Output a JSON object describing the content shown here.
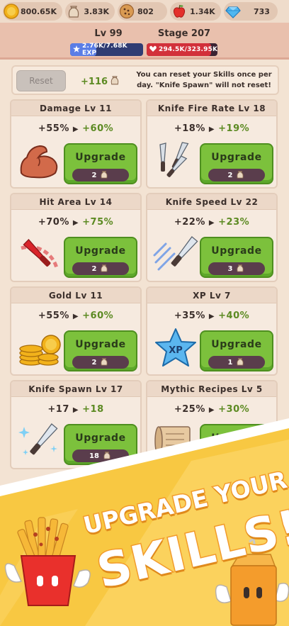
{
  "resources": [
    {
      "name": "coins",
      "value": "800.65K",
      "icon": "gold-coin-icon"
    },
    {
      "name": "flour",
      "value": "3.83K",
      "icon": "flour-sack-icon"
    },
    {
      "name": "cookies",
      "value": "802",
      "icon": "cookie-icon"
    },
    {
      "name": "apples",
      "value": "1.34K",
      "icon": "apple-icon"
    },
    {
      "name": "gems",
      "value": "733",
      "icon": "diamond-icon"
    }
  ],
  "header": {
    "level": "Lv 99",
    "stage": "Stage 207",
    "exp": {
      "text": "2.76K/7.68K EXP",
      "progress": 0.36
    },
    "hp": {
      "text": "294.5K/323.95K",
      "progress": 0.91
    }
  },
  "reset": {
    "button_label": "Reset",
    "count": "+116",
    "note": "You can reset your Skills once per day. \"Knife Spawn\" will not reset!"
  },
  "skills": [
    {
      "title": "Damage Lv 11",
      "current": "+55%",
      "next": "+60%",
      "upgrade_label": "Upgrade",
      "cost": "2",
      "icon": "flexed-arm-icon"
    },
    {
      "title": "Knife Fire Rate Lv 18",
      "current": "+18%",
      "next": "+19%",
      "upgrade_label": "Upgrade",
      "cost": "2",
      "icon": "triple-knives-icon"
    },
    {
      "title": "Hit Area Lv 14",
      "current": "+70%",
      "next": "+75%",
      "upgrade_label": "Upgrade",
      "cost": "2",
      "icon": "knife-arc-icon"
    },
    {
      "title": "Knife Speed Lv 22",
      "current": "+22%",
      "next": "+23%",
      "upgrade_label": "Upgrade",
      "cost": "3",
      "icon": "speed-knife-icon"
    },
    {
      "title": "Gold Lv 11",
      "current": "+55%",
      "next": "+60%",
      "upgrade_label": "Upgrade",
      "cost": "2",
      "icon": "coin-stack-icon"
    },
    {
      "title": "XP Lv 7",
      "current": "+35%",
      "next": "+40%",
      "upgrade_label": "Upgrade",
      "cost": "1",
      "icon": "xp-star-icon"
    },
    {
      "title": "Knife Spawn Lv 17",
      "current": "+17",
      "next": "+18",
      "upgrade_label": "Upgrade",
      "cost": "18",
      "icon": "sparkle-knife-icon"
    },
    {
      "title": "Mythic Recipes Lv 5",
      "current": "+25%",
      "next": "+30%",
      "upgrade_label": "Upgrade",
      "cost": "",
      "icon": "recipe-scroll-icon"
    }
  ],
  "promo": {
    "line1": "UPGRADE YOUR",
    "line2": "SKILLS!"
  },
  "colors": {
    "accent_green": "#7cc13c",
    "exp_blue": "#5a7de6",
    "hp_red": "#d2303a",
    "promo_orange": "#f29b2b"
  }
}
